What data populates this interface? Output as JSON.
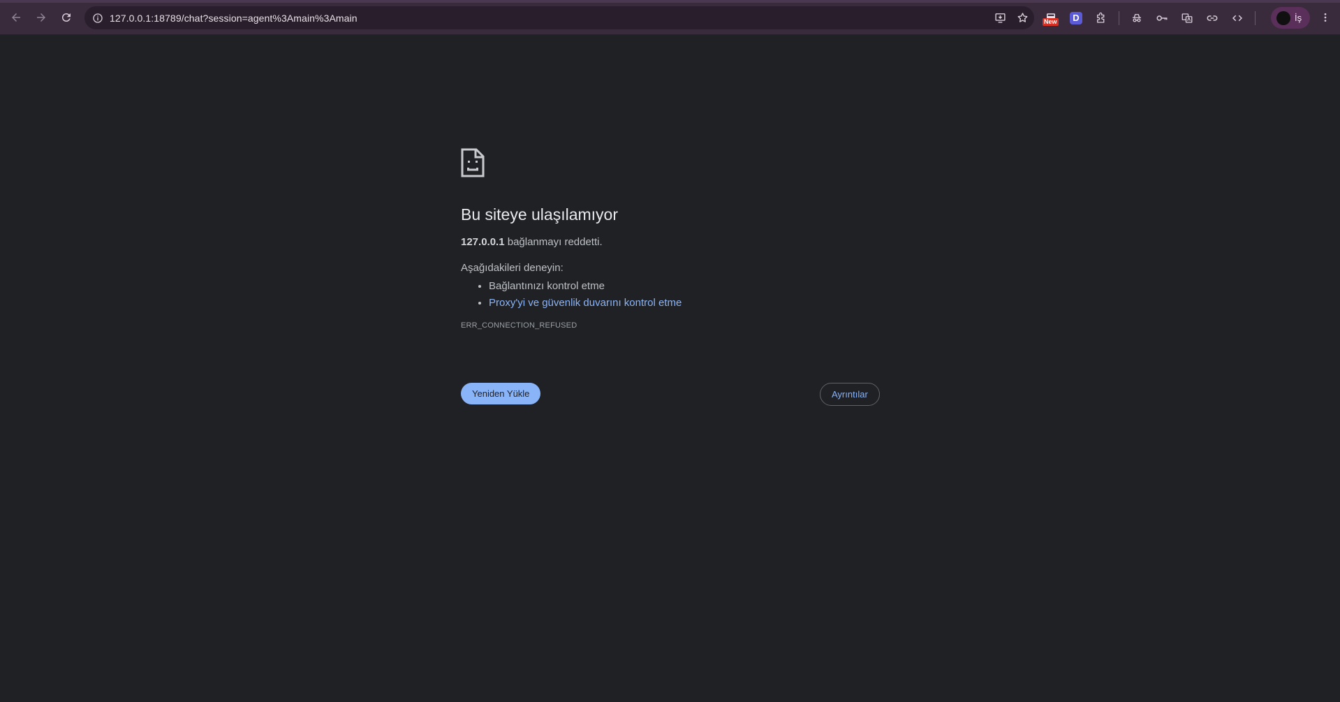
{
  "browser": {
    "url": "127.0.0.1:18789/chat?session=agent%3Amain%3Amain",
    "extension_badge": "New",
    "extension_letter": "D",
    "profile_label": "İş",
    "icons": [
      "back-icon",
      "forward-icon",
      "reload-icon",
      "site-info-icon",
      "install-app-icon",
      "bookmark-star-icon",
      "extension-news-icon",
      "extension-d-icon",
      "extensions-puzzle-icon",
      "incognito-icon",
      "password-key-icon",
      "translate-icon",
      "link-icon",
      "code-icon",
      "menu-kebab-icon"
    ],
    "colors": {
      "frame": "#3a2b3c",
      "omnibox": "#291e2b",
      "profile_chip": "#5a2f5a"
    }
  },
  "error_page": {
    "title": "Bu siteye ulaşılamıyor",
    "host": "127.0.0.1",
    "description_suffix": " bağlanmayı reddetti.",
    "try_heading": "Aşağıdakileri deneyin:",
    "suggestions": [
      "Bağlantınızı kontrol etme",
      "Proxy'yi ve güvenlik duvarını kontrol etme"
    ],
    "error_code": "ERR_CONNECTION_REFUSED",
    "reload_label": "Yeniden Yükle",
    "details_label": "Ayrıntılar",
    "colors": {
      "background": "#202124",
      "link": "#8ab4f8",
      "primary_button": "#8ab4f8"
    }
  }
}
